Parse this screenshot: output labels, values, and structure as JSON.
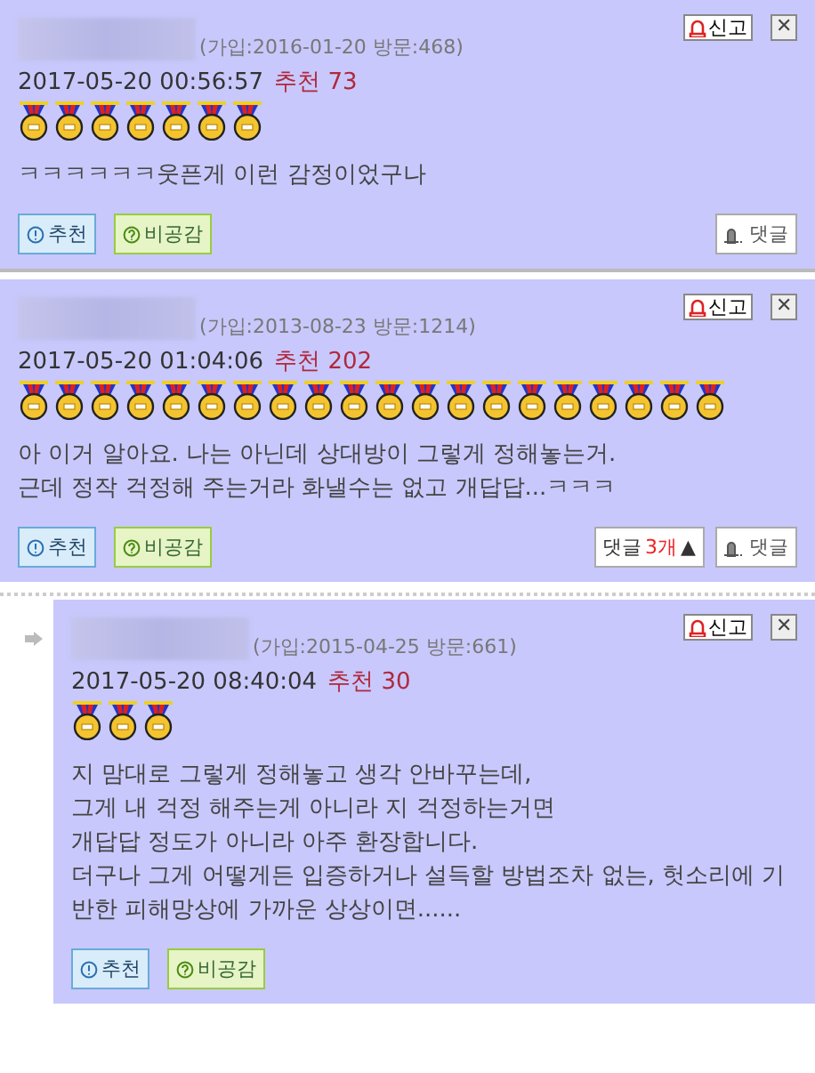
{
  "comments": [
    {
      "is_reply": false,
      "meta": "(가입:2016-01-20 방문:468)",
      "date": "2017-05-20 00:56:57",
      "recommend_label": "추천",
      "recommend_count": "73",
      "medals": [
        {
          "kind": "gold"
        },
        {
          "kind": "gold"
        },
        {
          "kind": "gold"
        },
        {
          "kind": "gold"
        },
        {
          "kind": "gold"
        },
        {
          "kind": "gold"
        },
        {
          "kind": "gold"
        }
      ],
      "body": [
        "ㅋㅋㅋㅋㅋㅋ웃픈게 이런 감정이었구나"
      ],
      "report": "신고",
      "close": "✕",
      "upvote": "추천",
      "downvote": "비공감",
      "reply_button": "댓글"
    },
    {
      "is_reply": false,
      "meta": "(가입:2013-08-23 방문:1214)",
      "date": "2017-05-20 01:04:06",
      "recommend_label": "추천",
      "recommend_count": "202",
      "medals": [
        {
          "kind": "gold"
        },
        {
          "kind": "gold"
        },
        {
          "kind": "gold"
        },
        {
          "kind": "gold"
        },
        {
          "kind": "gold"
        },
        {
          "kind": "gold"
        },
        {
          "kind": "gold"
        },
        {
          "kind": "gold"
        },
        {
          "kind": "gold"
        },
        {
          "kind": "gold"
        },
        {
          "kind": "gold"
        },
        {
          "kind": "gold"
        },
        {
          "kind": "gold"
        },
        {
          "kind": "gold"
        },
        {
          "kind": "gold"
        },
        {
          "kind": "gold"
        },
        {
          "kind": "gold"
        },
        {
          "kind": "gold"
        },
        {
          "kind": "gold"
        },
        {
          "kind": "gold"
        }
      ],
      "body": [
        "아 이거 알아요. 나는 아닌데 상대방이 그렇게 정해놓는거.",
        "근데 정작 걱정해 주는거라 화낼수는 없고 개답답...ㅋㅋㅋ"
      ],
      "report": "신고",
      "close": "✕",
      "upvote": "추천",
      "downvote": "비공감",
      "reply_toggle": {
        "label": "댓글",
        "count": "3개",
        "arrow": "▲"
      },
      "reply_button": "댓글"
    },
    {
      "is_reply": true,
      "meta": "(가입:2015-04-25 방문:661)",
      "date": "2017-05-20 08:40:04",
      "recommend_label": "추천",
      "recommend_count": "30",
      "medals": [
        {
          "kind": "gold"
        },
        {
          "kind": "gold"
        },
        {
          "kind": "gold"
        }
      ],
      "body": [
        "지 맘대로 그렇게 정해놓고 생각 안바꾸는데,",
        "그게 내 걱정 해주는게 아니라 지 걱정하는거면",
        "개답답 정도가 아니라 아주 환장합니다.",
        "더구나 그게 어떻게든 입증하거나 설득할 방법조차 없는, 헛소리에 기반한 피해망상에 가까운 상상이면......"
      ],
      "report": "신고",
      "close": "✕",
      "upvote": "추천",
      "downvote": "비공감"
    }
  ]
}
